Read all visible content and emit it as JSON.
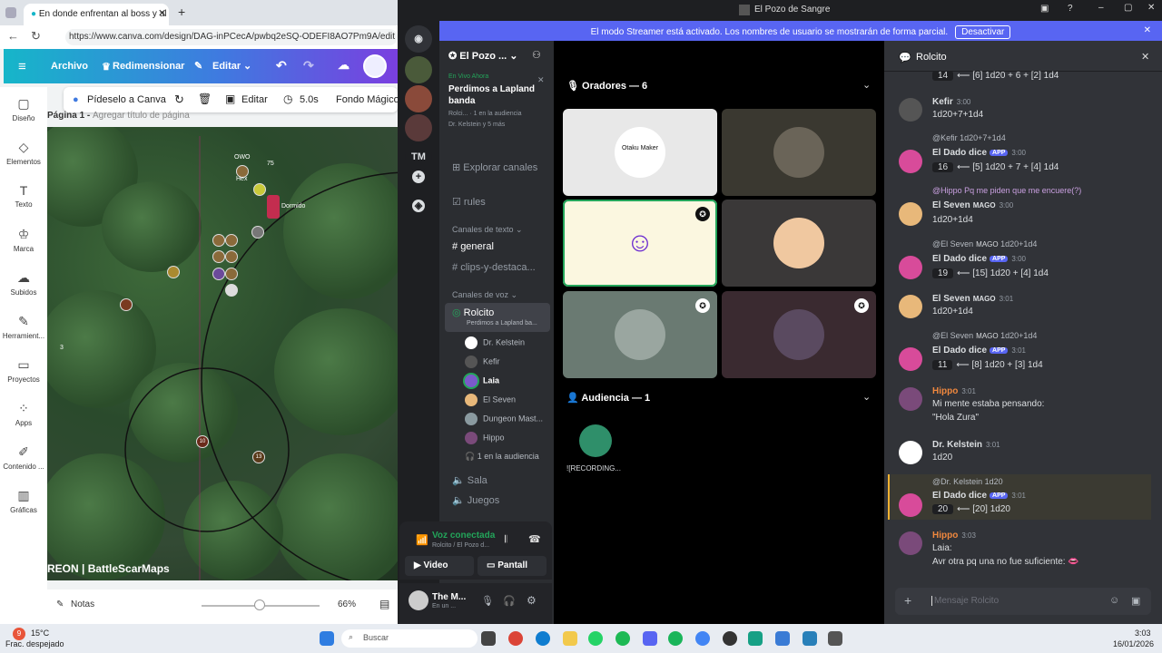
{
  "browser": {
    "tab_title": "En donde enfrentan al boss y al cr",
    "url": "https://www.canva.com/design/DAG-inPCecA/pwbq2eSQ-ODEFI8AO7Pm9A/edit",
    "canva": {
      "menu": {
        "file": "Archivo",
        "resize": "Redimensionar",
        "edit": "Editar"
      },
      "toolbar": {
        "ask": "Pídeselo a Canva",
        "edit": "Editar",
        "duration": "5.0s",
        "magic_bg": "Fondo Mágico"
      },
      "sidebar": [
        "Diseño",
        "Elementos",
        "Texto",
        "Marca",
        "Subidos",
        "Herramient...",
        "Proyectos",
        "Apps",
        "Contenido ...",
        "Gráficas"
      ],
      "page_label": "Página 1 - ",
      "page_title_placeholder": "Agregar título de página",
      "map_labels": {
        "owo": "OWO",
        "hex": "Hex",
        "num75": "75",
        "dormido": "Dormido",
        "num3": "3",
        "tok10": "10",
        "tok13": "13",
        "credit": "REON | BattleScarMaps"
      },
      "bottom": {
        "notes": "Notas",
        "zoom": "66%"
      }
    }
  },
  "discord": {
    "window_title": "El Pozo de Sangre",
    "streamer_banner": "El modo Streamer está activado. Los nombres de usuario se mostrarán de forma parcial.",
    "streamer_button": "Desactivar",
    "guild_tm": "TM",
    "server_name": "El Pozo ...",
    "live": {
      "tag": "En Vivo Ahora",
      "title": "Perdimos a Lapland banda",
      "sub1": "Rolci...",
      "sub1b": "1 en la audiencia",
      "sub2": "Dr. Kelstein y 5 más"
    },
    "explore": "Explorar canales",
    "rules": "rules",
    "text_header": "Canales de texto",
    "text_channels": [
      "general",
      "clips-y-destaca..."
    ],
    "voice_header": "Canales de voz",
    "voice_channel": "Rolcito",
    "voice_sub": "Perdimos a Lapland ba...",
    "voice_users": [
      "Dr. Kelstein",
      "Kefir",
      "Laia",
      "El Seven",
      "Dungeon Mast...",
      "Hippo"
    ],
    "voice_audience": "1 en la audiencia",
    "other_voice": [
      "Sala",
      "Juegos"
    ],
    "connected": {
      "status": "Voz conectada",
      "where": "Rolcito / El Pozo d...",
      "video": "Video",
      "screen": "Pantall"
    },
    "user": {
      "name": "The M...",
      "status": "En un ..."
    },
    "stage": {
      "speakers": "Oradores — 6",
      "audience": "Audiencia — 1",
      "audience_member": "![RECORDING...",
      "tile1_text": "Otaku Maker"
    },
    "thread": {
      "title": "Rolcito",
      "input_placeholder": "Mensaje Rolcito",
      "messages": [
        {
          "roll": "14",
          "text": "⟵ [6] 1d20 + 6 + [2] 1d4"
        },
        {
          "name": "Kefir",
          "time": "3:00",
          "text": "1d20+7+1d4"
        },
        {
          "reply": "@Kefir 1d20+7+1d4",
          "name": "El Dado dice",
          "badge": "APP",
          "time": "3:00",
          "roll": "16",
          "text": "⟵ [5] 1d20 + 7 + [4] 1d4"
        },
        {
          "reply": "@Hippo Pq me piden que me encuere(?)",
          "name": "El Seven",
          "badge": "MAGO",
          "time": "3:00",
          "text": "1d20+1d4"
        },
        {
          "reply": "@El Seven",
          "reply_badge": "MAGO",
          "reply_text": "1d20+1d4",
          "name": "El Dado dice",
          "badge": "APP",
          "time": "3:00",
          "roll": "19",
          "text": "⟵ [15] 1d20 + [4] 1d4"
        },
        {
          "name": "El Seven",
          "badge": "MAGO",
          "time": "3:01",
          "text": "1d20+1d4"
        },
        {
          "reply": "@El Seven",
          "reply_badge": "MAGO",
          "reply_text": "1d20+1d4",
          "name": "El Dado dice",
          "badge": "APP",
          "time": "3:01",
          "roll": "11",
          "text": "⟵ [8] 1d20 + [3] 1d4"
        },
        {
          "name": "Hippo",
          "time": "3:01",
          "text": "Mi mente estaba pensando:",
          "text2": "\"Hola Zura\""
        },
        {
          "name": "Dr. Kelstein",
          "time": "3:01",
          "text": "1d20"
        },
        {
          "reply": "@Dr. Kelstein 1d20",
          "name": "El Dado dice",
          "badge": "APP",
          "time": "3:01",
          "roll": "20",
          "text": "⟵ [20] 1d20"
        },
        {
          "name": "Hippo",
          "time": "3:03",
          "text": "Laia:",
          "text2": "Avr otra pq una no fue suficiente: 👄"
        }
      ]
    }
  },
  "taskbar": {
    "temp": "15°C",
    "weather": "Frac. despejado",
    "search": "Buscar",
    "time": "3:03",
    "date": "16/01/2026",
    "badge": "9"
  }
}
